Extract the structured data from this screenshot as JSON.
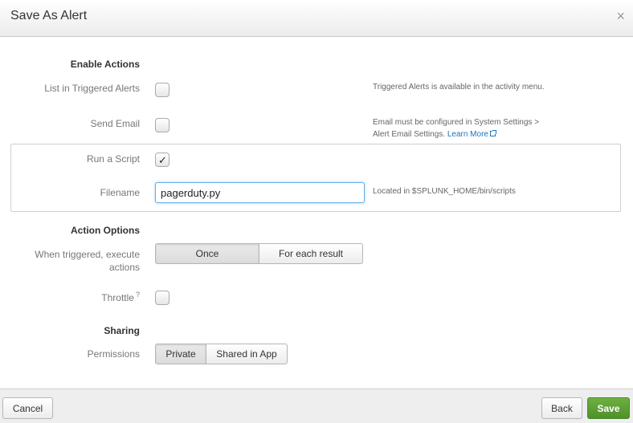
{
  "dialog": {
    "title": "Save As Alert",
    "close_glyph": "×"
  },
  "enable_actions": {
    "heading": "Enable Actions",
    "list_triggered": {
      "label": "List in Triggered Alerts",
      "checked": false,
      "help": "Triggered Alerts is available in the activity menu."
    },
    "send_email": {
      "label": "Send Email",
      "checked": false,
      "help_line1": "Email must be configured in System Settings >",
      "help_line2": "Alert Email Settings.",
      "learn_more": "Learn More"
    },
    "run_script": {
      "label": "Run a Script",
      "checked": true,
      "check_glyph": "✓"
    },
    "filename": {
      "label": "Filename",
      "value": "pagerduty.py",
      "help": "Located in $SPLUNK_HOME/bin/scripts"
    }
  },
  "action_options": {
    "heading": "Action Options",
    "execute_label_line1": "When triggered, execute",
    "execute_label_line2": "actions",
    "execute_options": [
      "Once",
      "For each result"
    ],
    "execute_selected": "Once",
    "throttle_label": "Throttle",
    "throttle_help_glyph": "?",
    "throttle_checked": false
  },
  "sharing": {
    "heading": "Sharing",
    "permissions_label": "Permissions",
    "permission_options": [
      "Private",
      "Shared in App"
    ],
    "permission_selected": "Private"
  },
  "footer": {
    "cancel": "Cancel",
    "back": "Back",
    "save": "Save"
  },
  "colors": {
    "save_button": "#5a9e33",
    "link": "#1e73be",
    "input_focus": "#66afe9"
  }
}
